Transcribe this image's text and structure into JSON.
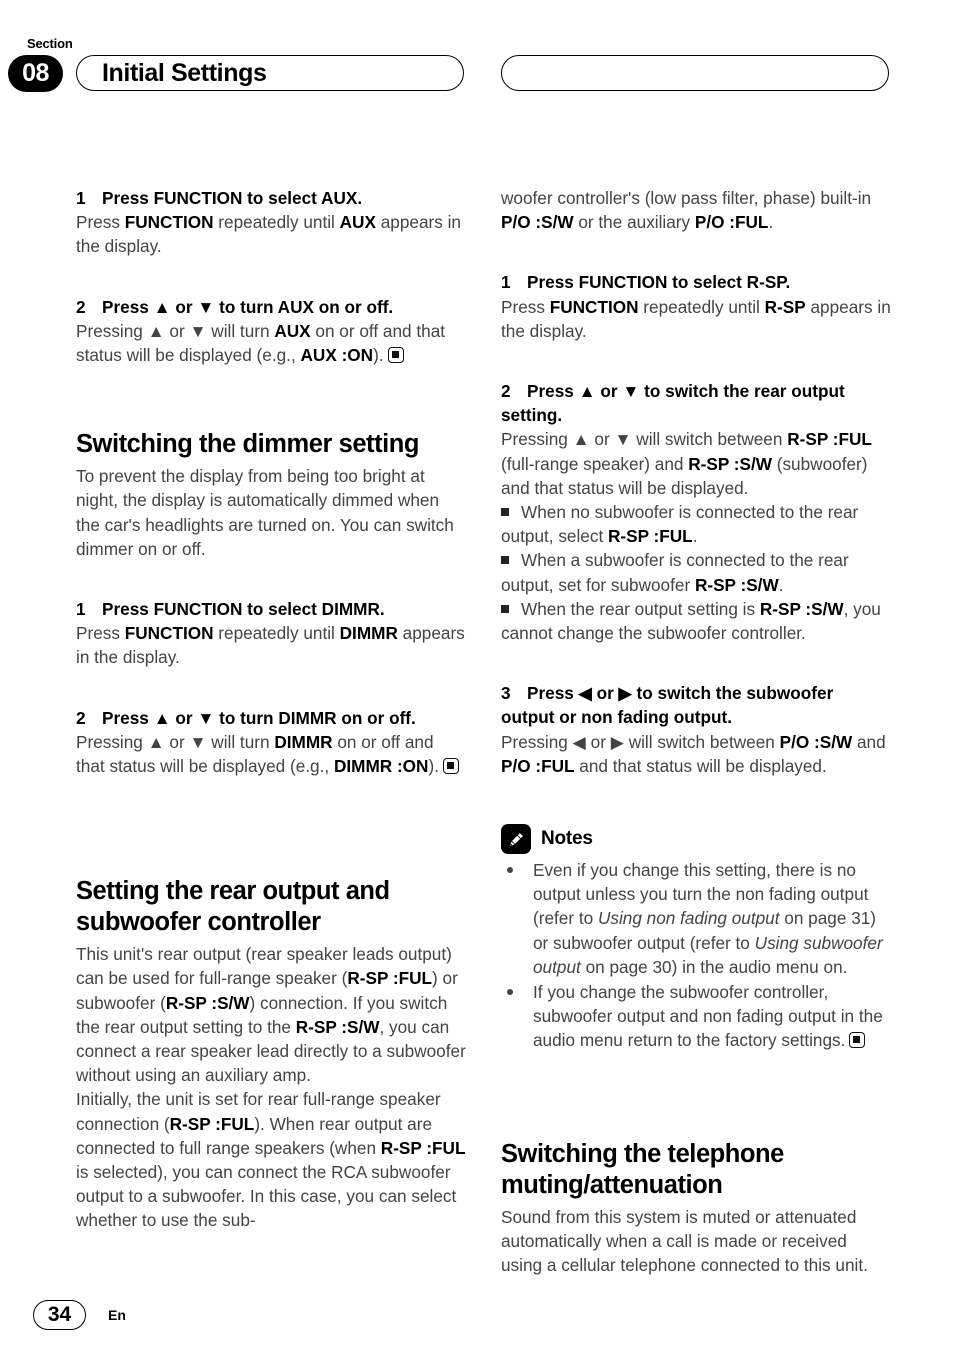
{
  "header": {
    "section_label": "Section",
    "section_number": "08",
    "title": "Initial Settings",
    "right_pill_title": ""
  },
  "left_column": {
    "step_aux_1_head_num": "1",
    "step_aux_1_head": "Press FUNCTION to select AUX.",
    "step_aux_1_body_a": "Press ",
    "step_aux_1_body_b": "FUNCTION",
    "step_aux_1_body_c": " repeatedly until ",
    "step_aux_1_body_d": "AUX",
    "step_aux_1_body_e": " appears in the display.",
    "step_aux_2_head_num": "2",
    "step_aux_2_head": "Press ▲ or ▼ to turn AUX on or off.",
    "step_aux_2_body_a": "Pressing ▲ or ▼ will turn ",
    "step_aux_2_body_b": "AUX",
    "step_aux_2_body_c": " on or off and that status will be displayed (e.g., ",
    "step_aux_2_body_d": "AUX :ON",
    "step_aux_2_body_e": ").",
    "dimmer_heading": "Switching the dimmer setting",
    "dimmer_intro": "To prevent the display from being too bright at night, the display is automatically dimmed when the car's headlights are turned on. You can switch dimmer on or off.",
    "step_dim_1_head_num": "1",
    "step_dim_1_head": "Press FUNCTION to select DIMMR.",
    "step_dim_1_body_a": "Press ",
    "step_dim_1_body_b": "FUNCTION",
    "step_dim_1_body_c": " repeatedly until ",
    "step_dim_1_body_d": "DIMMR",
    "step_dim_1_body_e": " appears in the display.",
    "step_dim_2_head_num": "2",
    "step_dim_2_head": "Press ▲ or ▼ to turn DIMMR on or off.",
    "step_dim_2_body_a": "Pressing ▲ or ▼ will turn ",
    "step_dim_2_body_b": "DIMMR",
    "step_dim_2_body_c": " on or off and that status will be displayed (e.g., ",
    "step_dim_2_body_d": "DIMMR :ON",
    "step_dim_2_body_e": ").",
    "rear_heading_line1": "Setting the rear output and",
    "rear_heading_line2": "subwoofer controller",
    "rear_body_a": "This unit's rear output (rear speaker leads output) can be used for full-range speaker (",
    "rear_body_b": "R-SP :FUL",
    "rear_body_c": ") or subwoofer (",
    "rear_body_d": "R-SP :S/W",
    "rear_body_e": ") connection. If you switch the rear output setting to the ",
    "rear_body_f": "R-SP :S/W",
    "rear_body_g": ", you can connect a rear speaker lead directly to a subwoofer without using an auxiliary amp.",
    "rear_body2_a": "Initially, the unit is set for rear full-range speaker connection (",
    "rear_body2_b": "R-SP :FUL",
    "rear_body2_c": "). When rear output are connected to full range speakers (when ",
    "rear_body2_d": "R-SP :FUL",
    "rear_body2_e": " is selected), you can connect the RCA subwoofer output to a subwoofer. In this case, you can select whether to use the sub-"
  },
  "right_column": {
    "cont_a": "woofer controller's (low pass filter, phase) built-in ",
    "cont_b": "P/O :S/W",
    "cont_c": " or the auxiliary ",
    "cont_d": "P/O :FUL",
    "cont_e": ".",
    "step_rsp_1_head_num": "1",
    "step_rsp_1_head": "Press FUNCTION to select R-SP.",
    "step_rsp_1_body_a": "Press ",
    "step_rsp_1_body_b": "FUNCTION",
    "step_rsp_1_body_c": " repeatedly until ",
    "step_rsp_1_body_d": "R-SP",
    "step_rsp_1_body_e": " appears in the display.",
    "step_rsp_2_head_num": "2",
    "step_rsp_2_head": "Press ▲ or ▼ to switch the rear output setting.",
    "step_rsp_2_body_a": "Pressing ▲ or ▼ will switch between ",
    "step_rsp_2_body_b": "R-SP :FUL",
    "step_rsp_2_body_c": " (full-range speaker) and ",
    "step_rsp_2_body_d": "R-SP :S/W",
    "step_rsp_2_body_e": " (subwoofer) and that status will be displayed.",
    "sq1_a": "When no subwoofer is connected to the rear output, select ",
    "sq1_b": "R-SP :FUL",
    "sq1_c": ".",
    "sq2_a": "When a subwoofer is connected to the rear output, set for subwoofer ",
    "sq2_b": "R-SP :S/W",
    "sq2_c": ".",
    "sq3_a": "When the rear output setting is ",
    "sq3_b": "R-SP :S/W",
    "sq3_c": ", you cannot change the subwoofer controller.",
    "step_po_3_head_num": "3",
    "step_po_3_head": "Press ◀ or ▶ to switch the subwoofer output or non fading output.",
    "step_po_3_body_a": "Pressing ◀ or ▶ will switch between ",
    "step_po_3_body_b": "P/O :S/W",
    "step_po_3_body_c": " and ",
    "step_po_3_body_d": "P/O :FUL",
    "step_po_3_body_e": " and that status will be displayed.",
    "notes_title": "Notes",
    "note1_a": "Even if you change this setting, there is no output unless you turn the non fading output (refer to ",
    "note1_b": "Using non fading output",
    "note1_c": " on page 31) or subwoofer output (refer to ",
    "note1_d": "Using subwoofer output",
    "note1_e": " on page 30) in the audio menu on.",
    "note2_a": "If you change the subwoofer controller, subwoofer output and non fading output in the audio menu return to the factory settings.",
    "phone_heading_line1": "Switching the telephone",
    "phone_heading_line2": "muting/attenuation",
    "phone_body": "Sound from this system is muted or attenuated automatically when a call is made or received using a cellular telephone connected to this unit."
  },
  "footer": {
    "page_number": "34",
    "language": "En"
  }
}
